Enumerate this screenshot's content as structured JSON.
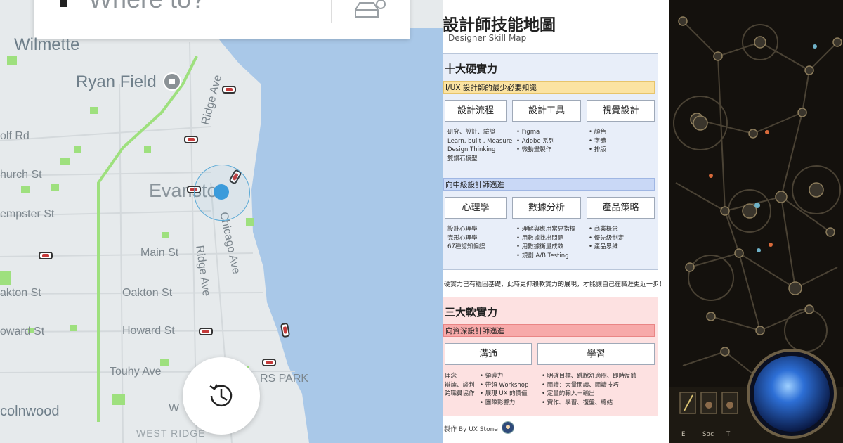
{
  "map": {
    "search": {
      "placeholder": "Where to?",
      "car_icon": "car-clock-icon"
    },
    "labels": {
      "wilmette": "Wilmette",
      "ryan_field": "Ryan Field",
      "ridge_ave_top": "Ridge Ave",
      "golf_rd": "olf Rd",
      "church_st": "hurch St",
      "evanston": "Evanston",
      "dempster_st": "empster St",
      "chicago_ave": "Chicago Ave",
      "main_st": "Main St",
      "ridge_ave_bottom": "Ridge Ave",
      "oakton_st_left": "akton St",
      "oakton_st": "Oakton St",
      "howard_st_left": "oward St",
      "howard_st": "Howard St",
      "touhy_ave": "Touhy Ave",
      "lincolnwood": "colnwood",
      "rogers_park": "RS PARK",
      "west_ridge": "WEST RIDGE",
      "w_partial": "W"
    },
    "history_icon": "history-clock-icon",
    "colors": {
      "water": "#a9c8e8",
      "land": "#e6eaec",
      "park": "#9ee07e",
      "location": "#3b9bdb"
    }
  },
  "skill_map": {
    "title": "設計師技能地圖",
    "subtitle": "Designer Skill Map",
    "hard": {
      "heading": "十大硬實力",
      "band1": "I/UX 設計師的最少必要知識",
      "cards1": [
        "設計流程",
        "設計工具",
        "視覺設計"
      ],
      "list1a": [
        "研究、設計、驗證",
        "Learn, built , Measure",
        "Design Thinking",
        "雙鑽石模型"
      ],
      "list1b": [
        "Figma",
        "Adobe 系列",
        "微動畫製作"
      ],
      "list1c": [
        "顏色",
        "字體",
        "排版"
      ],
      "band2": "向中級設計師邁進",
      "cards2": [
        "心理學",
        "數據分析",
        "產品策略"
      ],
      "list2a": [
        "設計心理學",
        "完形心理學",
        "67種認知偏誤"
      ],
      "list2b": [
        "理解與應用常見指標",
        "用數據找出問題",
        "用數據衡量成效",
        "規劃 A/B Testing"
      ],
      "list2c": [
        "商業概念",
        "優先級制定",
        "產品思維"
      ]
    },
    "note": "硬實力已有穩固基礎，此時更仰賴軟實力的展現，才能讓自己在職涯更近一步！",
    "soft": {
      "heading": "三大軟實力",
      "band": "向資深設計師邁進",
      "cards": [
        "溝通",
        "學習"
      ],
      "list_a": [
        "理念",
        "辯論、談判",
        "跨職員協作"
      ],
      "list_b": [
        "領導力",
        "帶領 Workshop",
        "展現 UX 的價值",
        "團隊影響力"
      ],
      "list_c": [
        "明確目標、跳脫舒適圈、即時反饋",
        "閱讀：大量閱讀、閱讀技巧",
        "定量的輸入＋輸出",
        "實作、學習、復盤、總結"
      ]
    },
    "credit": "製作 By UX Stone",
    "colors": {
      "hard_bg": "#e8eef9",
      "soft_bg": "#fde1e1",
      "yellow_band": "#fbe3a2",
      "blue_band": "#c9d8f6",
      "red_band": "#f7a9a9"
    }
  },
  "game": {
    "hud_keys": [
      "E",
      "Spc",
      "T"
    ],
    "icons": [
      "passive-skill-tree",
      "mana-orb-icon",
      "skill-slot-icon"
    ],
    "colors": {
      "bg": "#14110d",
      "orb": "#2d6fd6"
    }
  }
}
